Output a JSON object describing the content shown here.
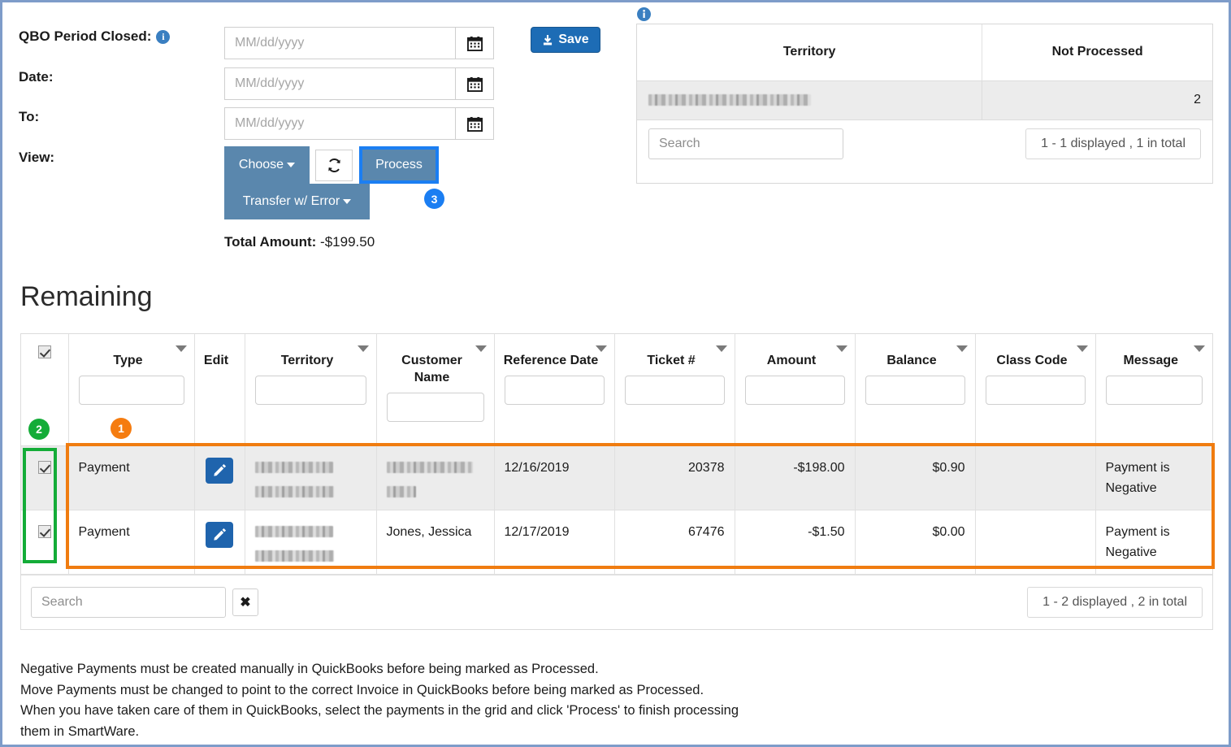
{
  "form": {
    "fields": [
      {
        "label": "QBO Period Closed:",
        "has_info": true,
        "value": "",
        "placeholder": "MM/dd/yyyy"
      },
      {
        "label": "Date:",
        "has_info": false,
        "value": "",
        "placeholder": "MM/dd/yyyy"
      },
      {
        "label": "To:",
        "has_info": false,
        "value": "",
        "placeholder": "MM/dd/yyyy"
      }
    ],
    "view_label": "View:",
    "save_label": "Save",
    "choose_label": "Choose",
    "transfer_label": "Transfer w/ Error",
    "process_label": "Process",
    "total_amount_label": "Total Amount:",
    "total_amount_value": "-$199.50"
  },
  "badges": {
    "one": "1",
    "two": "2",
    "three": "3"
  },
  "territory_panel": {
    "columns": [
      "Territory",
      "Not Processed"
    ],
    "rows": [
      {
        "territory": "",
        "not_processed": "2"
      }
    ],
    "search_placeholder": "Search",
    "search_value": "",
    "pager": "1 - 1 displayed , 1 in total"
  },
  "remaining": {
    "title": "Remaining",
    "columns": [
      "Type",
      "Edit",
      "Territory",
      "Customer Name",
      "Reference Date",
      "Ticket #",
      "Amount",
      "Balance",
      "Class Code",
      "Message"
    ],
    "rows": [
      {
        "checked": true,
        "type": "Payment",
        "territory": "",
        "customer_name": "",
        "reference_date": "12/16/2019",
        "ticket": "20378",
        "amount": "-$198.00",
        "balance": "$0.90",
        "class_code": "",
        "message": "Payment is Negative"
      },
      {
        "checked": true,
        "type": "Payment",
        "territory": "",
        "customer_name": "Jones, Jessica",
        "reference_date": "12/17/2019",
        "ticket": "67476",
        "amount": "-$1.50",
        "balance": "$0.00",
        "class_code": "",
        "message": "Payment is Negative"
      }
    ],
    "search_placeholder": "Search",
    "search_value": "",
    "clear_label": "✖",
    "pager": "1 - 2 displayed , 2 in total"
  },
  "notes": {
    "line1": "Negative Payments must be created manually in QuickBooks before being marked as Processed.",
    "line2": "Move Payments must be changed to point to the correct Invoice in QuickBooks before being marked as Processed.",
    "line3": "When you have taken care of them in QuickBooks, select the payments in the grid and click 'Process' to finish processing",
    "line4": "them in SmartWare."
  },
  "colors": {
    "accent_blue": "#1d6cb5",
    "slate_blue": "#5a87ad",
    "highlight_blue": "#1b7ef2",
    "highlight_orange": "#f07c10",
    "highlight_green": "#14ac38",
    "page_border": "#7e9cc9"
  }
}
